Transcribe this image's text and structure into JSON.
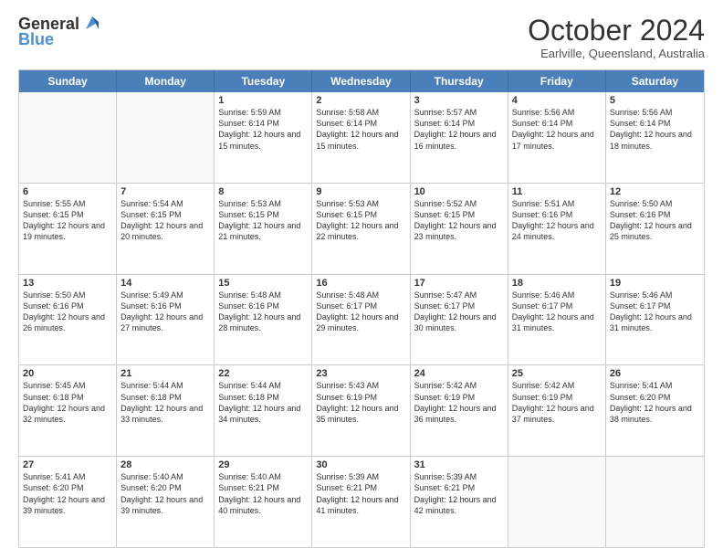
{
  "logo": {
    "general": "General",
    "blue": "Blue"
  },
  "header": {
    "month": "October 2024",
    "location": "Earlville, Queensland, Australia"
  },
  "days": [
    "Sunday",
    "Monday",
    "Tuesday",
    "Wednesday",
    "Thursday",
    "Friday",
    "Saturday"
  ],
  "weeks": [
    [
      {
        "day": "",
        "text": ""
      },
      {
        "day": "",
        "text": ""
      },
      {
        "day": "1",
        "text": "Sunrise: 5:59 AM\nSunset: 6:14 PM\nDaylight: 12 hours and 15 minutes."
      },
      {
        "day": "2",
        "text": "Sunrise: 5:58 AM\nSunset: 6:14 PM\nDaylight: 12 hours and 15 minutes."
      },
      {
        "day": "3",
        "text": "Sunrise: 5:57 AM\nSunset: 6:14 PM\nDaylight: 12 hours and 16 minutes."
      },
      {
        "day": "4",
        "text": "Sunrise: 5:56 AM\nSunset: 6:14 PM\nDaylight: 12 hours and 17 minutes."
      },
      {
        "day": "5",
        "text": "Sunrise: 5:56 AM\nSunset: 6:14 PM\nDaylight: 12 hours and 18 minutes."
      }
    ],
    [
      {
        "day": "6",
        "text": "Sunrise: 5:55 AM\nSunset: 6:15 PM\nDaylight: 12 hours and 19 minutes."
      },
      {
        "day": "7",
        "text": "Sunrise: 5:54 AM\nSunset: 6:15 PM\nDaylight: 12 hours and 20 minutes."
      },
      {
        "day": "8",
        "text": "Sunrise: 5:53 AM\nSunset: 6:15 PM\nDaylight: 12 hours and 21 minutes."
      },
      {
        "day": "9",
        "text": "Sunrise: 5:53 AM\nSunset: 6:15 PM\nDaylight: 12 hours and 22 minutes."
      },
      {
        "day": "10",
        "text": "Sunrise: 5:52 AM\nSunset: 6:15 PM\nDaylight: 12 hours and 23 minutes."
      },
      {
        "day": "11",
        "text": "Sunrise: 5:51 AM\nSunset: 6:16 PM\nDaylight: 12 hours and 24 minutes."
      },
      {
        "day": "12",
        "text": "Sunrise: 5:50 AM\nSunset: 6:16 PM\nDaylight: 12 hours and 25 minutes."
      }
    ],
    [
      {
        "day": "13",
        "text": "Sunrise: 5:50 AM\nSunset: 6:16 PM\nDaylight: 12 hours and 26 minutes."
      },
      {
        "day": "14",
        "text": "Sunrise: 5:49 AM\nSunset: 6:16 PM\nDaylight: 12 hours and 27 minutes."
      },
      {
        "day": "15",
        "text": "Sunrise: 5:48 AM\nSunset: 6:16 PM\nDaylight: 12 hours and 28 minutes."
      },
      {
        "day": "16",
        "text": "Sunrise: 5:48 AM\nSunset: 6:17 PM\nDaylight: 12 hours and 29 minutes."
      },
      {
        "day": "17",
        "text": "Sunrise: 5:47 AM\nSunset: 6:17 PM\nDaylight: 12 hours and 30 minutes."
      },
      {
        "day": "18",
        "text": "Sunrise: 5:46 AM\nSunset: 6:17 PM\nDaylight: 12 hours and 31 minutes."
      },
      {
        "day": "19",
        "text": "Sunrise: 5:46 AM\nSunset: 6:17 PM\nDaylight: 12 hours and 31 minutes."
      }
    ],
    [
      {
        "day": "20",
        "text": "Sunrise: 5:45 AM\nSunset: 6:18 PM\nDaylight: 12 hours and 32 minutes."
      },
      {
        "day": "21",
        "text": "Sunrise: 5:44 AM\nSunset: 6:18 PM\nDaylight: 12 hours and 33 minutes."
      },
      {
        "day": "22",
        "text": "Sunrise: 5:44 AM\nSunset: 6:18 PM\nDaylight: 12 hours and 34 minutes."
      },
      {
        "day": "23",
        "text": "Sunrise: 5:43 AM\nSunset: 6:19 PM\nDaylight: 12 hours and 35 minutes."
      },
      {
        "day": "24",
        "text": "Sunrise: 5:42 AM\nSunset: 6:19 PM\nDaylight: 12 hours and 36 minutes."
      },
      {
        "day": "25",
        "text": "Sunrise: 5:42 AM\nSunset: 6:19 PM\nDaylight: 12 hours and 37 minutes."
      },
      {
        "day": "26",
        "text": "Sunrise: 5:41 AM\nSunset: 6:20 PM\nDaylight: 12 hours and 38 minutes."
      }
    ],
    [
      {
        "day": "27",
        "text": "Sunrise: 5:41 AM\nSunset: 6:20 PM\nDaylight: 12 hours and 39 minutes."
      },
      {
        "day": "28",
        "text": "Sunrise: 5:40 AM\nSunset: 6:20 PM\nDaylight: 12 hours and 39 minutes."
      },
      {
        "day": "29",
        "text": "Sunrise: 5:40 AM\nSunset: 6:21 PM\nDaylight: 12 hours and 40 minutes."
      },
      {
        "day": "30",
        "text": "Sunrise: 5:39 AM\nSunset: 6:21 PM\nDaylight: 12 hours and 41 minutes."
      },
      {
        "day": "31",
        "text": "Sunrise: 5:39 AM\nSunset: 6:21 PM\nDaylight: 12 hours and 42 minutes."
      },
      {
        "day": "",
        "text": ""
      },
      {
        "day": "",
        "text": ""
      }
    ]
  ]
}
